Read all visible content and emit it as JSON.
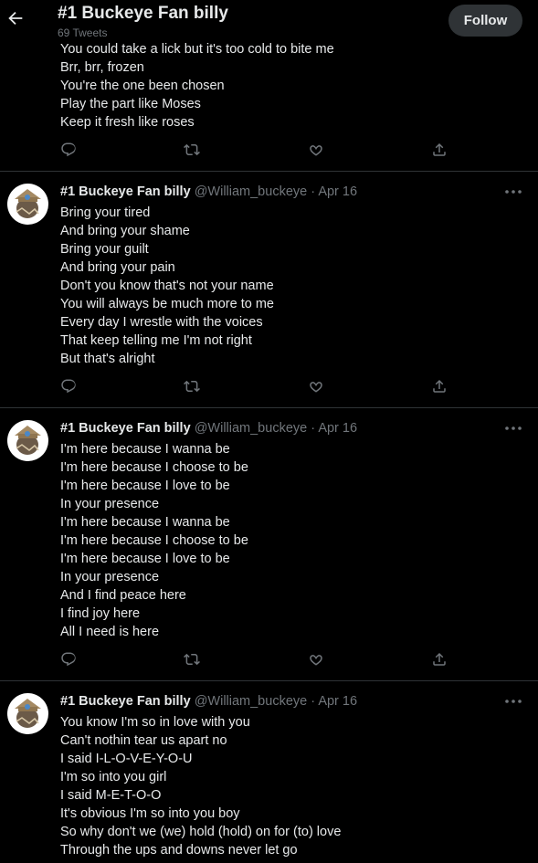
{
  "header": {
    "title": "#1 Buckeye Fan billy",
    "tweet_count": "69 Tweets",
    "follow_label": "Follow"
  },
  "first_tweet": {
    "lines": [
      "You could take a lick but it's too cold to bite me",
      "Brr, brr, frozen",
      "You're the one been chosen",
      "Play the part like Moses",
      "Keep it fresh like roses"
    ]
  },
  "tweets": [
    {
      "name": "#1 Buckeye Fan billy",
      "handle": "@William_buckeye",
      "separator": "·",
      "date": "Apr 16",
      "lines": [
        "Bring your tired",
        "And bring your shame",
        "Bring your guilt",
        "And bring your pain",
        "Don't you know that's not your name",
        "You will always be much more to me",
        "Every day I wrestle with the voices",
        "That keep telling me I'm not right",
        "But that's alright"
      ]
    },
    {
      "name": "#1 Buckeye Fan billy",
      "handle": "@William_buckeye",
      "separator": "·",
      "date": "Apr 16",
      "lines": [
        "I'm here because I wanna be",
        "I'm here because I choose to be",
        "I'm here because I love to be",
        "In your presence",
        "I'm here because I wanna be",
        "I'm here because I choose to be",
        "I'm here because I love to be",
        "In your presence",
        "And I find peace here",
        "I find joy here",
        "All I need is here"
      ]
    },
    {
      "name": "#1 Buckeye Fan billy",
      "handle": "@William_buckeye",
      "separator": "·",
      "date": "Apr 16",
      "lines": [
        "You know I'm so in love with you",
        "Can't nothin tear us apart no",
        "I said I-L-O-V-E-Y-O-U",
        "I'm so into you girl",
        "I said M-E-T-O-O",
        "It's obvious I'm so into you boy",
        "So why don't we (we) hold (hold) on  for (to) love",
        "Through the ups and downs never let go"
      ]
    }
  ],
  "icons": {
    "back": "arrow-left-icon",
    "reply": "reply-icon",
    "retweet": "retweet-icon",
    "like": "heart-icon",
    "share": "share-icon",
    "more": "more-icon"
  },
  "colors": {
    "background": "#000000",
    "text": "#e7e9ea",
    "secondary": "#71767b",
    "divider": "#2f3336",
    "follow_bg": "#2f3336"
  }
}
